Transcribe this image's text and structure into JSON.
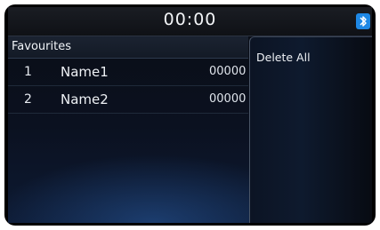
{
  "status_bar": {
    "time": "00:00",
    "bluetooth_icon": "bluetooth-icon",
    "accent": "#1e88e5"
  },
  "favourites": {
    "title": "Favourites",
    "rows": [
      {
        "index": "1",
        "name": "Name1",
        "number": "00000"
      },
      {
        "index": "2",
        "name": "Name2",
        "number": "00000"
      }
    ]
  },
  "menu": {
    "delete_all_label": "Delete All"
  }
}
